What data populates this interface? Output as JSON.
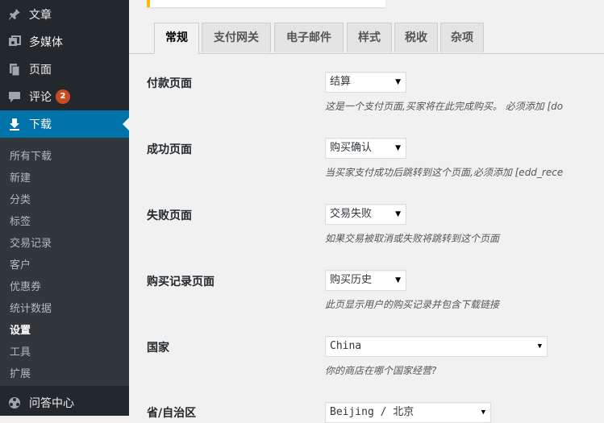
{
  "sidebar": {
    "top_items": [
      {
        "label": "文章",
        "icon": "pushpin-icon"
      },
      {
        "label": "多媒体",
        "icon": "media-icon"
      },
      {
        "label": "页面",
        "icon": "pages-icon"
      },
      {
        "label": "评论",
        "icon": "comment-icon",
        "badge": "2"
      },
      {
        "label": "下载",
        "icon": "download-icon",
        "current": true
      }
    ],
    "submenu": [
      "所有下载",
      "新建",
      "分类",
      "标签",
      "交易记录",
      "客户",
      "优惠券",
      "统计数据",
      "设置",
      "工具",
      "扩展"
    ],
    "submenu_current": "设置",
    "bottom_item": {
      "label": "问答中心",
      "icon": "community-icon"
    }
  },
  "tabs": [
    "常规",
    "支付网关",
    "电子邮件",
    "样式",
    "税收",
    "杂项"
  ],
  "active_tab": "常规",
  "settings": [
    {
      "label": "付款页面",
      "value": "结算",
      "description": "这是一个支付页面,买家将在此完成购买。 必须添加 [do"
    },
    {
      "label": "成功页面",
      "value": "购买确认",
      "description": "当买家支付成功后跳转到这个页面,必须添加 [edd_rece"
    },
    {
      "label": "失败页面",
      "value": "交易失败",
      "description": "如果交易被取消或失败将跳转到这个页面"
    },
    {
      "label": "购买记录页面",
      "value": "购买历史",
      "description": "此页显示用户的购买记录并包含下载链接"
    },
    {
      "label": "国家",
      "value": "China",
      "description": "你的商店在哪个国家经营?"
    },
    {
      "label": "省/自治区",
      "value": "Beijing / 北京",
      "description": ""
    }
  ],
  "colors": {
    "sidebar_bg": "#23282d",
    "submenu_bg": "#32373c",
    "accent": "#0073aa",
    "badge": "#ca4a1f",
    "notice": "#ffb900"
  }
}
